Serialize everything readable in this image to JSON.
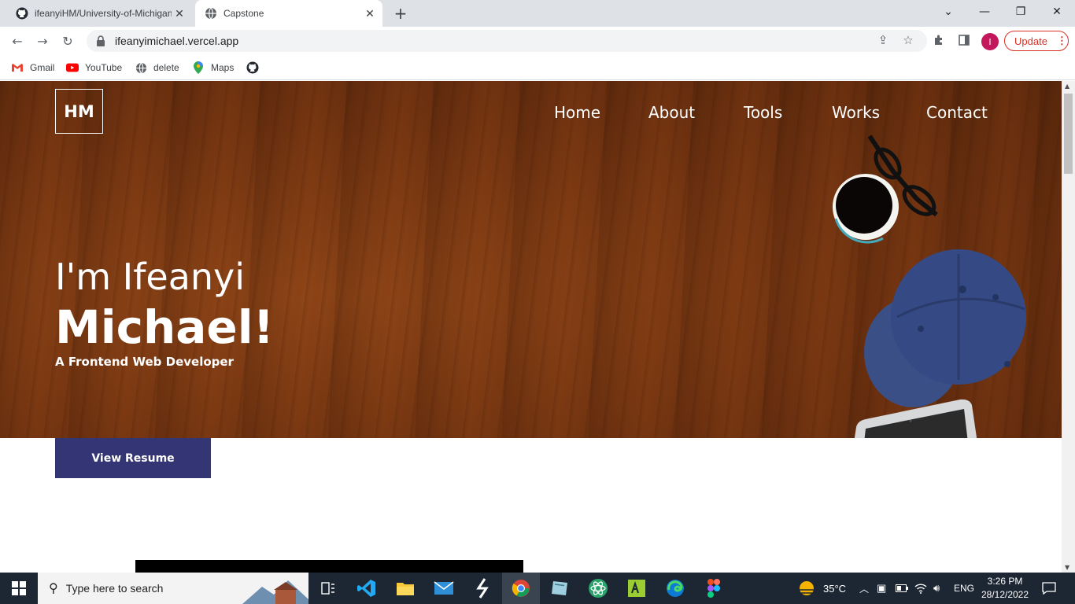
{
  "browser": {
    "tabs": [
      {
        "title": "ifeanyiHM/University-of-Michigan",
        "icon": "github-icon"
      },
      {
        "title": "Capstone",
        "icon": "globe-icon"
      }
    ],
    "url": "ifeanyimichael.vercel.app",
    "update_label": "Update",
    "profile_initial": "I",
    "bookmarks": [
      {
        "label": "Gmail",
        "icon": "gmail-icon"
      },
      {
        "label": "YouTube",
        "icon": "youtube-icon"
      },
      {
        "label": "delete",
        "icon": "globe-icon"
      },
      {
        "label": "Maps",
        "icon": "maps-icon"
      },
      {
        "label": "",
        "icon": "github-icon"
      }
    ]
  },
  "site": {
    "logo": "HM",
    "nav": [
      "Home",
      "About",
      "Tools",
      "Works",
      "Contact"
    ],
    "hero": {
      "line1": "I'm Ifeanyi",
      "line2": "Michael!",
      "subtitle": "A Frontend Web Developer"
    },
    "resume_button": "View Resume",
    "colors": {
      "button": "#343574",
      "hero_wood": "#7a3a12"
    }
  },
  "taskbar": {
    "search_placeholder": "Type here to search",
    "weather": "35°C",
    "language": "ENG",
    "time": "3:26 PM",
    "date": "28/12/2022"
  }
}
